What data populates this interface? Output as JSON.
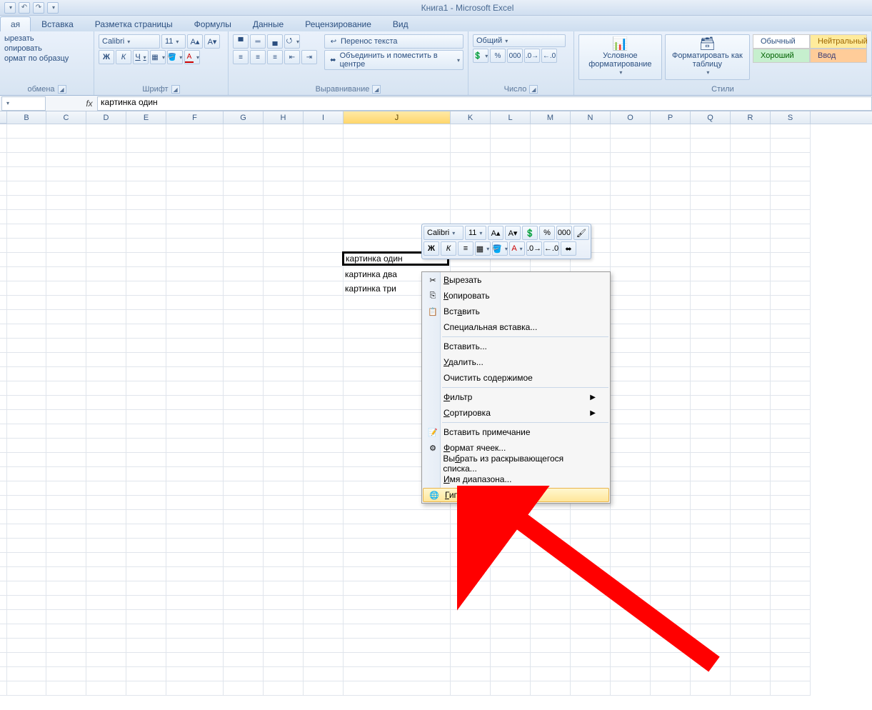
{
  "title": "Книга1 - Microsoft Excel",
  "qat": {
    "undo": "↶",
    "redo": "↷"
  },
  "tabs": [
    "ая",
    "Вставка",
    "Разметка страницы",
    "Формулы",
    "Данные",
    "Рецензирование",
    "Вид"
  ],
  "activeTab": 0,
  "clipboard": {
    "cut": "ырезать",
    "copy": "опировать",
    "formatPainter": "ормат по образцу",
    "label": "обмена"
  },
  "font": {
    "name": "Calibri",
    "size": "11",
    "bold": "Ж",
    "italic": "К",
    "underline": "Ч",
    "label": "Шрифт"
  },
  "align": {
    "wrap": "Перенос текста",
    "merge": "Объединить и поместить в центре",
    "label": "Выравнивание"
  },
  "number": {
    "format": "Общий",
    "label": "Число"
  },
  "styles": {
    "conditional": "Условное форматирование",
    "asTable": "Форматировать как таблицу",
    "label": "Стили",
    "cells": {
      "normal": "Обычный",
      "neutral": "Нейтральный",
      "good": "Хороший",
      "input": "Ввод"
    }
  },
  "formulaBar": {
    "nameBox": "",
    "fx": "fx",
    "value": "картинка один"
  },
  "columns": [
    "B",
    "C",
    "D",
    "E",
    "F",
    "G",
    "H",
    "I",
    "J",
    "K",
    "L",
    "M",
    "N",
    "O",
    "P",
    "Q",
    "R",
    "S"
  ],
  "selectedCol": "J",
  "colWidths": {
    "B": 55,
    "C": 56,
    "D": 56,
    "E": 56,
    "F": 80,
    "G": 56,
    "H": 56,
    "I": 56,
    "J": 150,
    "K": 56,
    "L": 56,
    "M": 56,
    "N": 56,
    "O": 56,
    "P": 56,
    "Q": 56,
    "R": 56,
    "S": 56
  },
  "cells": {
    "J10": "картинка один",
    "J11": "картинка два",
    "J12": "картинка три"
  },
  "miniToolbar": {
    "font": "Calibri",
    "size": "11"
  },
  "contextMenu": {
    "items": [
      {
        "icon": "✂",
        "label": "Вырезать",
        "hot": "В"
      },
      {
        "icon": "⎘",
        "label": "Копировать",
        "hot": "К"
      },
      {
        "icon": "📋",
        "label": "Вставить",
        "hot": "а"
      },
      {
        "icon": "",
        "label": "Специальная вставка...",
        "hot": ""
      },
      {
        "sep": true
      },
      {
        "icon": "",
        "label": "Вставить...",
        "hot": ""
      },
      {
        "icon": "",
        "label": "Удалить...",
        "hot": "У"
      },
      {
        "icon": "",
        "label": "Очистить содержимое",
        "hot": ""
      },
      {
        "sep": true
      },
      {
        "icon": "",
        "label": "Фильтр",
        "hot": "Ф",
        "sub": true
      },
      {
        "icon": "",
        "label": "Сортировка",
        "hot": "С",
        "sub": true
      },
      {
        "sep": true
      },
      {
        "icon": "📝",
        "label": "Вставить примечание",
        "hot": ""
      },
      {
        "icon": "⚙",
        "label": "Формат ячеек...",
        "hot": "Ф"
      },
      {
        "icon": "",
        "label": "Выбрать из раскрывающегося списка...",
        "hot": "б"
      },
      {
        "icon": "",
        "label": "Имя диапазона...",
        "hot": "И"
      },
      {
        "icon": "🌐",
        "label": "Гиперссылка...",
        "hot": "Г",
        "hl": true
      }
    ]
  }
}
